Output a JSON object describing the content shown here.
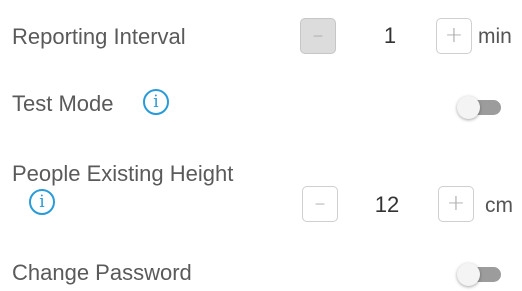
{
  "settings": {
    "reporting_interval": {
      "label": "Reporting Interval",
      "minus": "–",
      "value": "1",
      "plus": "+",
      "unit": "min"
    },
    "test_mode": {
      "label": "Test Mode",
      "info": "i",
      "enabled": false
    },
    "people_existing_height": {
      "label": "People Existing Height",
      "info": "i",
      "minus": "–",
      "value": "12",
      "plus": "+",
      "unit": "cm"
    },
    "change_password": {
      "label": "Change Password",
      "enabled": false
    }
  },
  "colors": {
    "info_accent": "#2a9bd8",
    "toggle_off_track": "#9c9c9c"
  }
}
